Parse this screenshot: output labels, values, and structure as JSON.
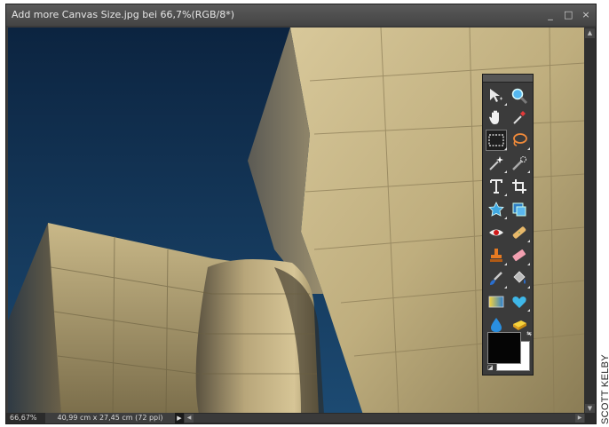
{
  "window": {
    "title": "Add more Canvas Size.jpg bei 66,7%(RGB/8*)",
    "buttons": {
      "minimize": "_",
      "maximize": "□",
      "close": "×"
    }
  },
  "status": {
    "zoom": "66,67%",
    "doc_info": "40,99 cm x 27,45 cm (72 ppi)",
    "menu_arrow": "▶"
  },
  "credit": "SCOTT KELBY",
  "toolbox": {
    "tools": [
      {
        "icon": "move-tool-icon"
      },
      {
        "icon": "zoom-tool-icon"
      },
      {
        "icon": "hand-tool-icon"
      },
      {
        "icon": "eyedropper-tool-icon"
      },
      {
        "icon": "rectangular-marquee-tool-icon",
        "selected": true
      },
      {
        "icon": "lasso-tool-icon"
      },
      {
        "icon": "magic-wand-tool-icon"
      },
      {
        "icon": "quick-selection-tool-icon"
      },
      {
        "icon": "type-tool-icon"
      },
      {
        "icon": "crop-tool-icon"
      },
      {
        "icon": "cookie-cutter-tool-icon"
      },
      {
        "icon": "recompose-tool-icon"
      },
      {
        "icon": "red-eye-tool-icon"
      },
      {
        "icon": "healing-brush-tool-icon"
      },
      {
        "icon": "clone-stamp-tool-icon"
      },
      {
        "icon": "eraser-tool-icon"
      },
      {
        "icon": "brush-tool-icon"
      },
      {
        "icon": "paint-bucket-tool-icon"
      },
      {
        "icon": "gradient-tool-icon"
      },
      {
        "icon": "custom-shape-tool-icon"
      },
      {
        "icon": "blur-tool-icon"
      },
      {
        "icon": "sponge-tool-icon"
      }
    ],
    "foreground_color": "#050505",
    "background_color": "#ffffff"
  },
  "colors": {
    "sky": "#0f2a44",
    "metal_light": "#c8b88a",
    "metal_dark": "#6f6446",
    "accent_blue": "#3fa7e0"
  }
}
